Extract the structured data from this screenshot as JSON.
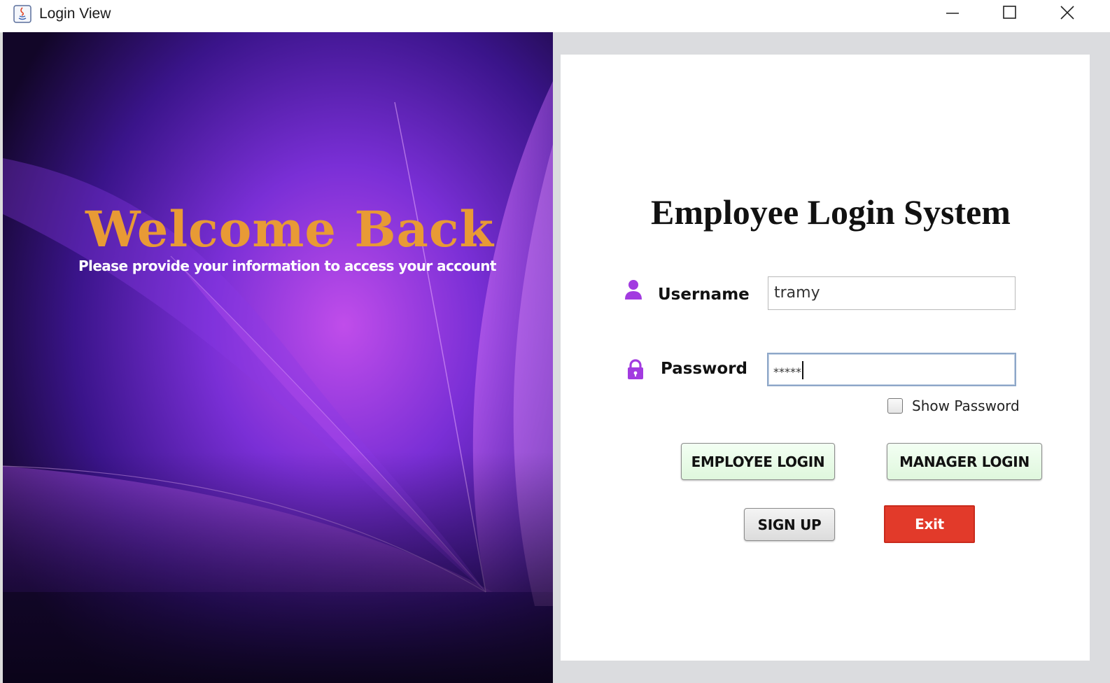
{
  "window": {
    "title": "Login View"
  },
  "left": {
    "welcome_title": "Welcome Back",
    "subtitle": "Please provide your information to access your account"
  },
  "form": {
    "heading": "Employee Login System",
    "username_label": "Username",
    "username_value": "tramy",
    "password_label": "Password",
    "password_value": "*****",
    "show_password_label": "Show Password",
    "show_password_checked": false
  },
  "buttons": {
    "employee_login": "EMPLOYEE LOGIN",
    "manager_login": "MANAGER LOGIN",
    "sign_up": "SIGN UP",
    "exit": "Exit"
  },
  "colors": {
    "welcome": "#e89a35",
    "icon_purple": "#a23be0",
    "exit_red": "#e23a2a",
    "login_green": "#e4f8e2"
  },
  "icons": {
    "app": "java-coffee-icon",
    "username": "user-icon",
    "password": "lock-icon"
  }
}
